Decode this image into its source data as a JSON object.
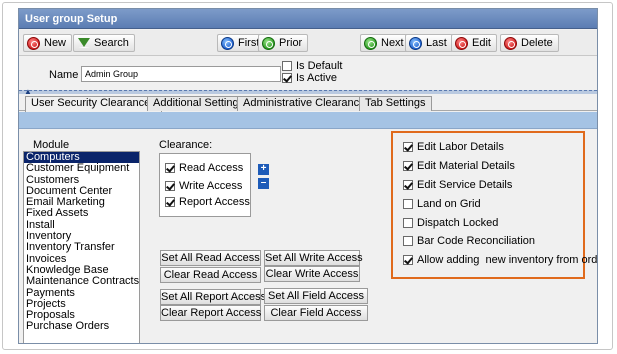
{
  "window": {
    "title": "User group Setup"
  },
  "toolbar": {
    "new": "New",
    "search": "Search",
    "first": "First",
    "prior": "Prior",
    "next": "Next",
    "last": "Last",
    "edit": "Edit",
    "delete": "Delete"
  },
  "header": {
    "name_label": "Name",
    "name_value": "Admin Group",
    "is_default": {
      "label": "Is Default",
      "checked": false
    },
    "is_active": {
      "label": "Is Active",
      "checked": true
    }
  },
  "tabs": [
    "User Security Clearances",
    "Additional Settings",
    "Administrative Clearances",
    "Tab Settings"
  ],
  "module": {
    "label": "Module",
    "selected": "Computers",
    "items": [
      "Computers",
      "Customer Equipment",
      "Customers",
      "Document Center",
      "Email Marketing",
      "Fixed Assets",
      "Install",
      "Inventory",
      "Inventory Transfer",
      "Invoices",
      "Knowledge Base",
      "Maintenance Contracts",
      "Payments",
      "Projects",
      "Proposals",
      "Purchase Orders"
    ]
  },
  "clearance": {
    "label": "Clearance:",
    "items": [
      {
        "label": "Read Access",
        "checked": true
      },
      {
        "label": "Write Access",
        "checked": true
      },
      {
        "label": "Report Access",
        "checked": true
      }
    ],
    "plus": "+",
    "minus": "–"
  },
  "buttons": {
    "set_all_read": "Set All Read Access",
    "set_all_write": "Set All Write Access",
    "clear_read": "Clear Read Access",
    "clear_write": "Clear Write Access",
    "set_all_report": "Set All Report Access",
    "set_all_field": "Set All Field Access",
    "clear_report": "Clear Report Access",
    "clear_field": "Clear Field Access"
  },
  "options": [
    {
      "label": "Edit Labor Details",
      "checked": true
    },
    {
      "label": "Edit Material Details",
      "checked": true
    },
    {
      "label": "Edit Service Details",
      "checked": true
    },
    {
      "label": "Land on Grid",
      "checked": false
    },
    {
      "label": "Dispatch Locked",
      "checked": false
    },
    {
      "label": "Bar Code Reconciliation",
      "checked": false
    },
    {
      "label": "Allow adding  new inventory from orders",
      "checked": true
    }
  ],
  "colors": {
    "title_bar": "#5b7db3",
    "band": "#a5c3e4",
    "highlight_border": "#e06a1c",
    "selection": "#0a246a"
  }
}
